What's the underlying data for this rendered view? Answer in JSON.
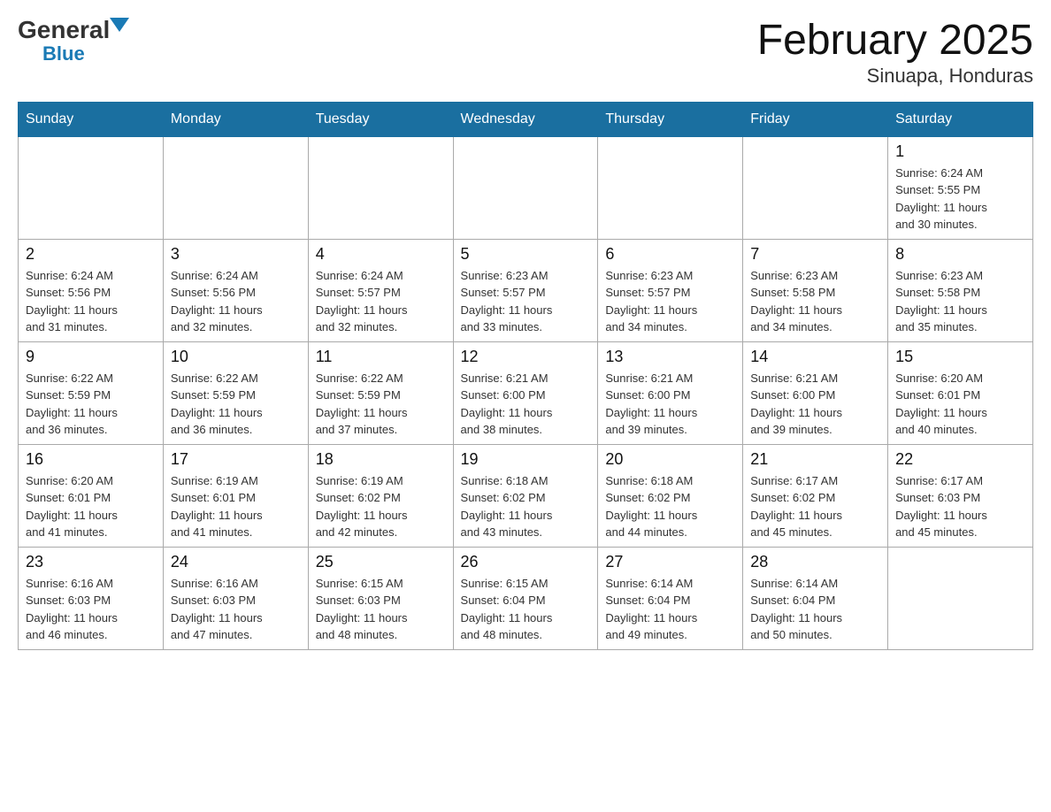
{
  "logo": {
    "general": "General",
    "blue": "Blue"
  },
  "title": "February 2025",
  "subtitle": "Sinuapa, Honduras",
  "days_header": [
    "Sunday",
    "Monday",
    "Tuesday",
    "Wednesday",
    "Thursday",
    "Friday",
    "Saturday"
  ],
  "weeks": [
    [
      {
        "day": "",
        "info": ""
      },
      {
        "day": "",
        "info": ""
      },
      {
        "day": "",
        "info": ""
      },
      {
        "day": "",
        "info": ""
      },
      {
        "day": "",
        "info": ""
      },
      {
        "day": "",
        "info": ""
      },
      {
        "day": "1",
        "info": "Sunrise: 6:24 AM\nSunset: 5:55 PM\nDaylight: 11 hours\nand 30 minutes."
      }
    ],
    [
      {
        "day": "2",
        "info": "Sunrise: 6:24 AM\nSunset: 5:56 PM\nDaylight: 11 hours\nand 31 minutes."
      },
      {
        "day": "3",
        "info": "Sunrise: 6:24 AM\nSunset: 5:56 PM\nDaylight: 11 hours\nand 32 minutes."
      },
      {
        "day": "4",
        "info": "Sunrise: 6:24 AM\nSunset: 5:57 PM\nDaylight: 11 hours\nand 32 minutes."
      },
      {
        "day": "5",
        "info": "Sunrise: 6:23 AM\nSunset: 5:57 PM\nDaylight: 11 hours\nand 33 minutes."
      },
      {
        "day": "6",
        "info": "Sunrise: 6:23 AM\nSunset: 5:57 PM\nDaylight: 11 hours\nand 34 minutes."
      },
      {
        "day": "7",
        "info": "Sunrise: 6:23 AM\nSunset: 5:58 PM\nDaylight: 11 hours\nand 34 minutes."
      },
      {
        "day": "8",
        "info": "Sunrise: 6:23 AM\nSunset: 5:58 PM\nDaylight: 11 hours\nand 35 minutes."
      }
    ],
    [
      {
        "day": "9",
        "info": "Sunrise: 6:22 AM\nSunset: 5:59 PM\nDaylight: 11 hours\nand 36 minutes."
      },
      {
        "day": "10",
        "info": "Sunrise: 6:22 AM\nSunset: 5:59 PM\nDaylight: 11 hours\nand 36 minutes."
      },
      {
        "day": "11",
        "info": "Sunrise: 6:22 AM\nSunset: 5:59 PM\nDaylight: 11 hours\nand 37 minutes."
      },
      {
        "day": "12",
        "info": "Sunrise: 6:21 AM\nSunset: 6:00 PM\nDaylight: 11 hours\nand 38 minutes."
      },
      {
        "day": "13",
        "info": "Sunrise: 6:21 AM\nSunset: 6:00 PM\nDaylight: 11 hours\nand 39 minutes."
      },
      {
        "day": "14",
        "info": "Sunrise: 6:21 AM\nSunset: 6:00 PM\nDaylight: 11 hours\nand 39 minutes."
      },
      {
        "day": "15",
        "info": "Sunrise: 6:20 AM\nSunset: 6:01 PM\nDaylight: 11 hours\nand 40 minutes."
      }
    ],
    [
      {
        "day": "16",
        "info": "Sunrise: 6:20 AM\nSunset: 6:01 PM\nDaylight: 11 hours\nand 41 minutes."
      },
      {
        "day": "17",
        "info": "Sunrise: 6:19 AM\nSunset: 6:01 PM\nDaylight: 11 hours\nand 41 minutes."
      },
      {
        "day": "18",
        "info": "Sunrise: 6:19 AM\nSunset: 6:02 PM\nDaylight: 11 hours\nand 42 minutes."
      },
      {
        "day": "19",
        "info": "Sunrise: 6:18 AM\nSunset: 6:02 PM\nDaylight: 11 hours\nand 43 minutes."
      },
      {
        "day": "20",
        "info": "Sunrise: 6:18 AM\nSunset: 6:02 PM\nDaylight: 11 hours\nand 44 minutes."
      },
      {
        "day": "21",
        "info": "Sunrise: 6:17 AM\nSunset: 6:02 PM\nDaylight: 11 hours\nand 45 minutes."
      },
      {
        "day": "22",
        "info": "Sunrise: 6:17 AM\nSunset: 6:03 PM\nDaylight: 11 hours\nand 45 minutes."
      }
    ],
    [
      {
        "day": "23",
        "info": "Sunrise: 6:16 AM\nSunset: 6:03 PM\nDaylight: 11 hours\nand 46 minutes."
      },
      {
        "day": "24",
        "info": "Sunrise: 6:16 AM\nSunset: 6:03 PM\nDaylight: 11 hours\nand 47 minutes."
      },
      {
        "day": "25",
        "info": "Sunrise: 6:15 AM\nSunset: 6:03 PM\nDaylight: 11 hours\nand 48 minutes."
      },
      {
        "day": "26",
        "info": "Sunrise: 6:15 AM\nSunset: 6:04 PM\nDaylight: 11 hours\nand 48 minutes."
      },
      {
        "day": "27",
        "info": "Sunrise: 6:14 AM\nSunset: 6:04 PM\nDaylight: 11 hours\nand 49 minutes."
      },
      {
        "day": "28",
        "info": "Sunrise: 6:14 AM\nSunset: 6:04 PM\nDaylight: 11 hours\nand 50 minutes."
      },
      {
        "day": "",
        "info": ""
      }
    ]
  ]
}
